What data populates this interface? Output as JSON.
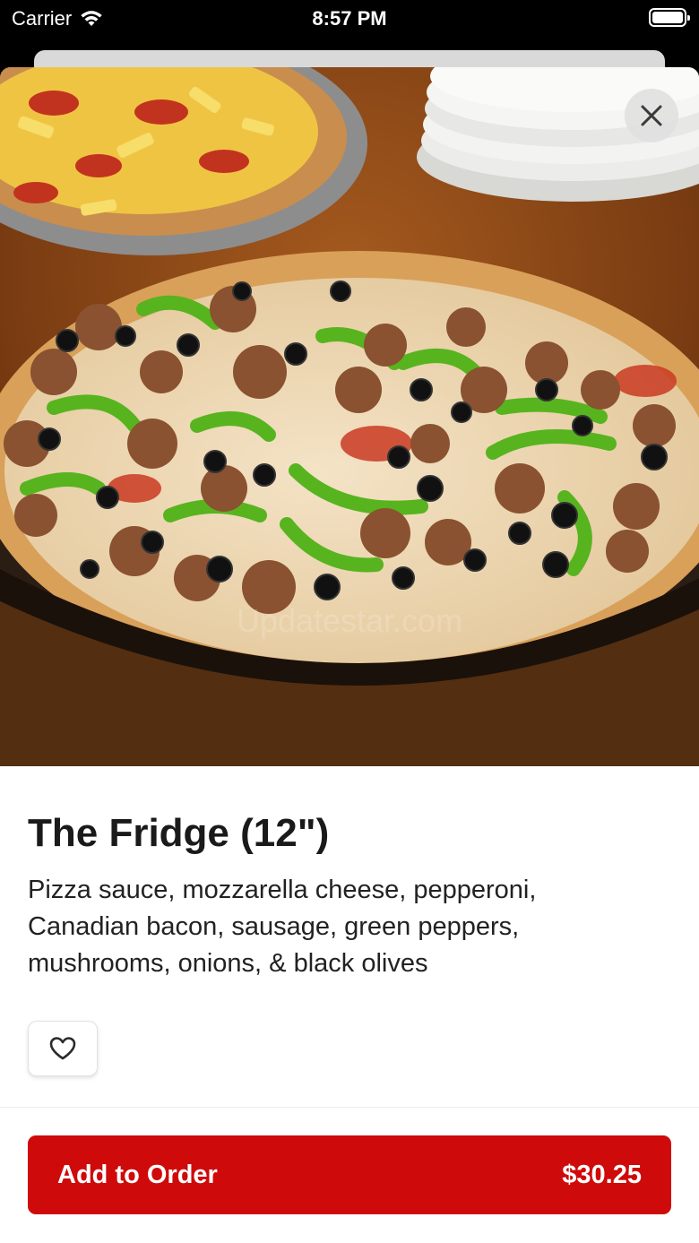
{
  "status_bar": {
    "carrier": "Carrier",
    "time": "8:57 PM",
    "wifi_icon": "wifi-icon",
    "battery_icon": "battery-icon"
  },
  "product": {
    "image_icon": "pizza-photo",
    "image_watermark": "Updatestar.com",
    "title": "The Fridge (12\")",
    "description": "Pizza sauce, mozzarella cheese, pepperoni, Canadian bacon, sausage, green peppers, mushrooms, onions, & black olives"
  },
  "actions": {
    "close_icon": "close-icon",
    "favorite_icon": "heart-icon",
    "add_label": "Add to Order",
    "price": "$30.25"
  },
  "colors": {
    "accent": "#cf0a0a",
    "background": "#ffffff",
    "status_bar": "#000000"
  }
}
